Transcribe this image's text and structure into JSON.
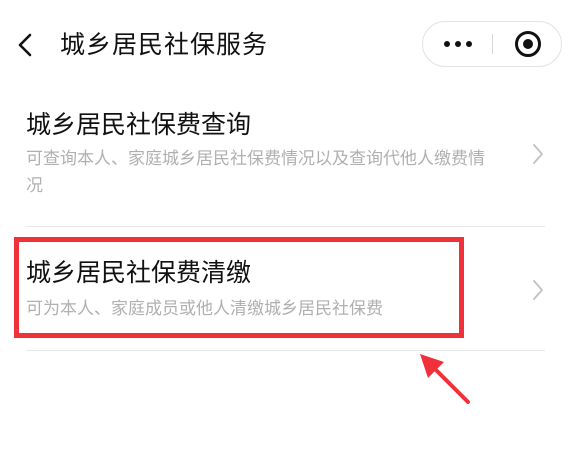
{
  "header": {
    "title": "城乡居民社保服务",
    "back_icon": "chevron-left-icon",
    "more_icon": "more-dots-icon",
    "close_icon": "target-circle-icon"
  },
  "items": [
    {
      "title": "城乡居民社保费查询",
      "description": "可查询本人、家庭城乡居民社保费情况以及查询代他人缴费情况"
    },
    {
      "title": "城乡居民社保费清缴",
      "description": "可为本人、家庭成员或他人清缴城乡居民社保费"
    }
  ],
  "colors": {
    "highlight": "#f0313b",
    "text_primary": "#111111",
    "text_secondary": "#b0b0b0"
  }
}
